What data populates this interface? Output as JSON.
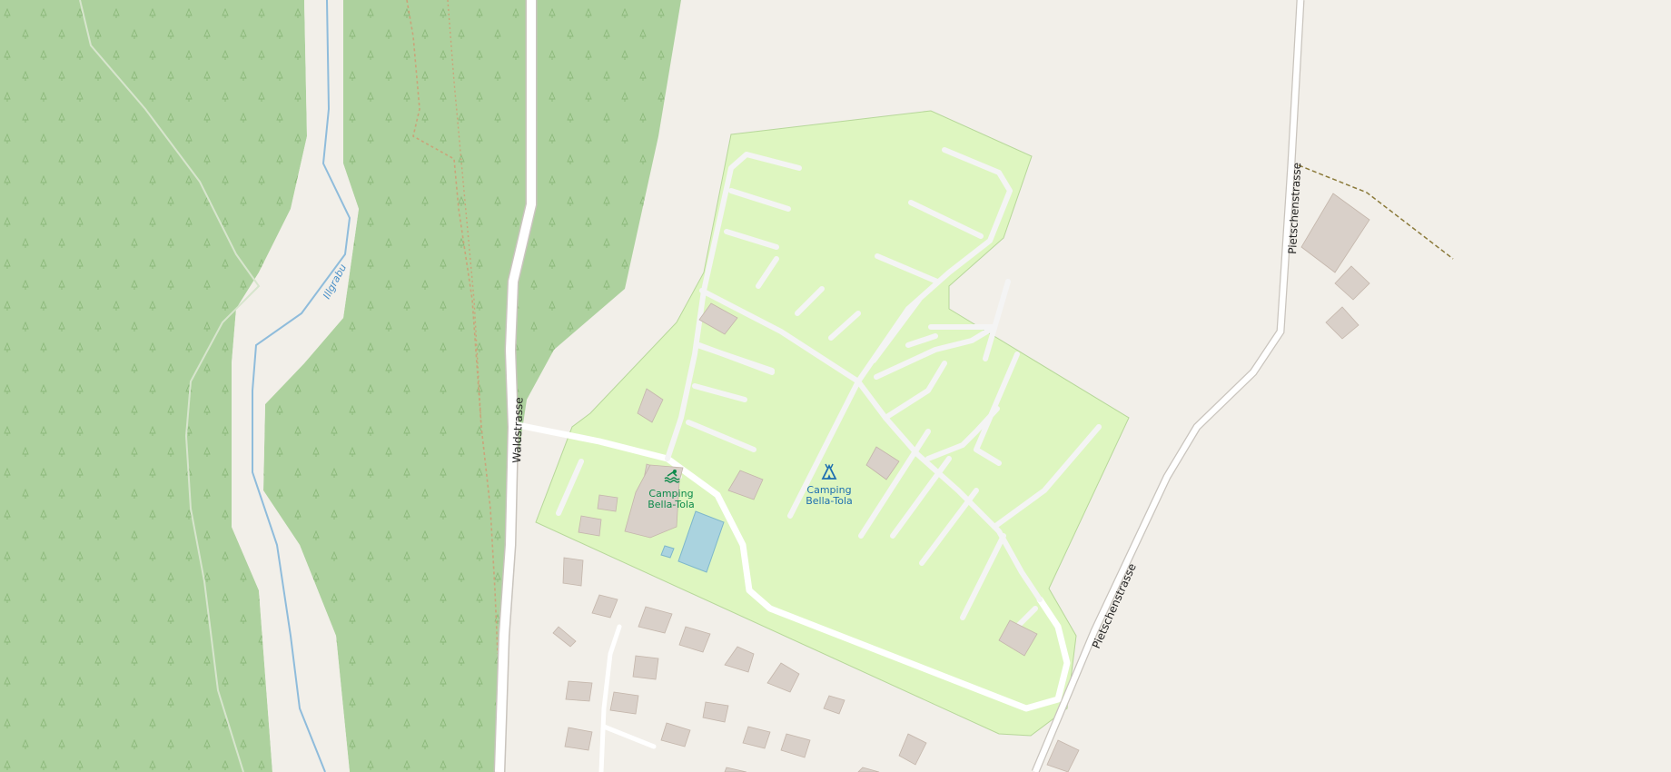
{
  "map": {
    "labels": {
      "stream": "Illgrabu",
      "road_west": "Waldstrasse",
      "road_east_upper": "Pietschenstrasse",
      "road_east_lower": "Pietschenstrasse",
      "poi_pool_line1": "Camping",
      "poi_pool_line2": "Bella-Tola",
      "poi_camp_line1": "Camping",
      "poi_camp_line2": "Bella-Tola"
    },
    "colors": {
      "background": "#f2efe9",
      "forest": "#add19e",
      "campsite": "#def6c0",
      "building": "#d9d0c9",
      "water": "#aad3df",
      "stream": "#8fbcdb",
      "road": "#ffffff",
      "path": "#c9a47a",
      "track": "#8b7a3a",
      "poi_pool": "#0e8a4b",
      "poi_camp": "#1e6fb0"
    },
    "icons": [
      "tree-pattern",
      "swimming-icon",
      "campsite-tent-icon"
    ]
  }
}
